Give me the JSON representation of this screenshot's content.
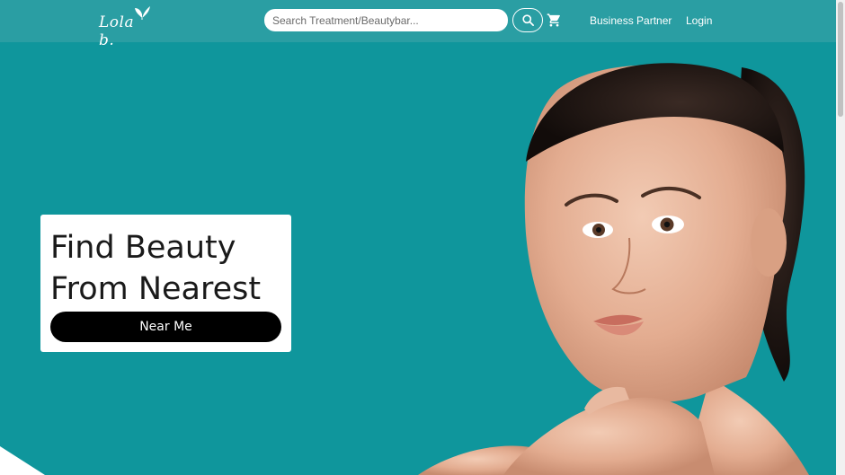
{
  "header": {
    "logo_text": "Lola b.",
    "search_placeholder": "Search Treatment/Beautybar...",
    "search_value": "",
    "nav": {
      "business_partner": "Business Partner",
      "login": "Login"
    }
  },
  "hero": {
    "title_line1": "Find Beauty",
    "title_line2": "From Nearest",
    "button_label": "Near Me"
  },
  "colors": {
    "background": "#0f969c",
    "topbar": "#2a9ea3",
    "button": "#000000",
    "card": "#ffffff"
  },
  "icons": {
    "search": "search-icon",
    "cart": "cart-icon",
    "logo_leaf": "butterfly-icon"
  }
}
